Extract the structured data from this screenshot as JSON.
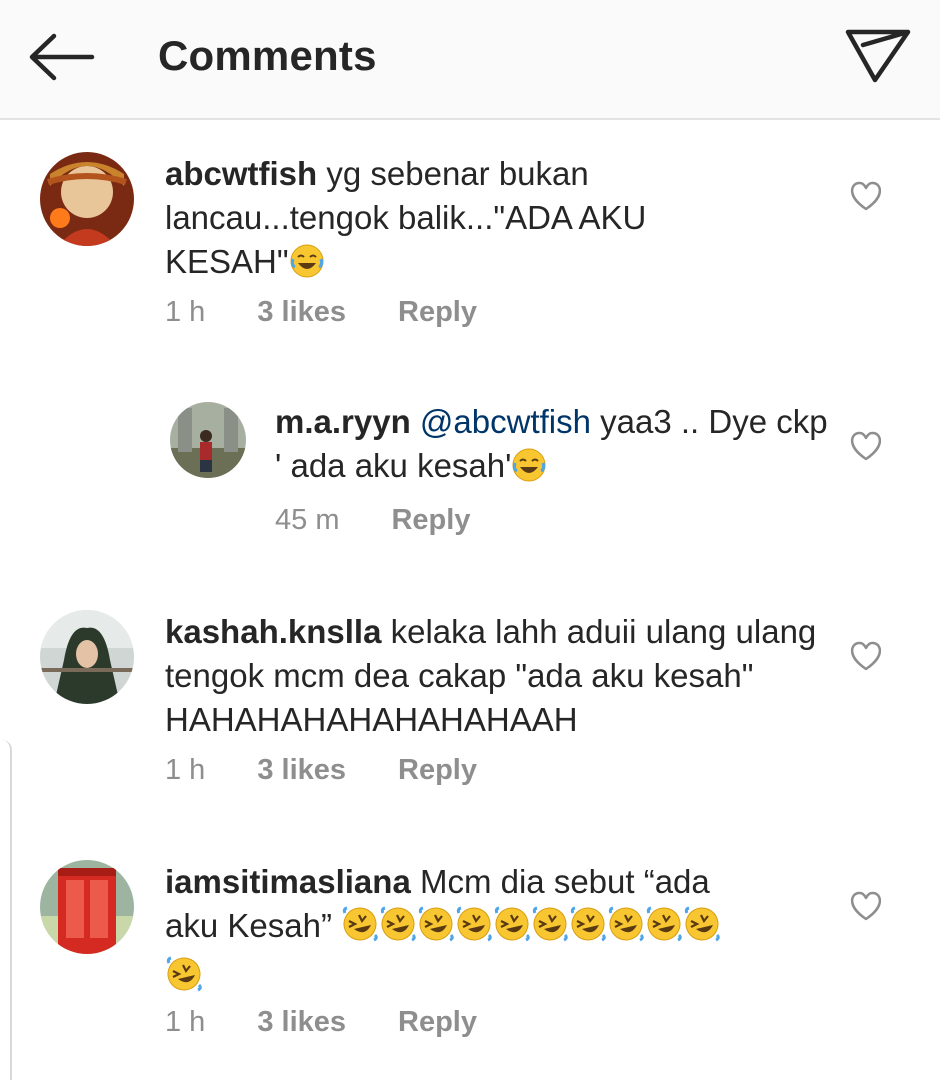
{
  "header": {
    "title": "Comments",
    "back_icon": "arrow-left-icon",
    "send_icon": "paper-plane-icon"
  },
  "comments": [
    {
      "username": "abcwtfish",
      "text": "yg sebenar bukan lancau...tengok balik...\"ADA AKU KESAH\"",
      "emoji": [
        "😂"
      ],
      "time": "1 h",
      "likes": "3 likes",
      "reply": "Reply"
    },
    {
      "username": "m.a.ryyn",
      "mention": "@abcwtfish",
      "text": "yaa3 .. Dye ckp ' ada aku kesah'",
      "emoji": [
        "😂"
      ],
      "time": "45 m",
      "reply": "Reply"
    },
    {
      "username": "kashah.knslla",
      "text": "kelaka lahh aduii ulang ulang tengok mcm dea cakap \"ada aku kesah\" HAHAHAHAHAHAHAHAAH",
      "time": "1 h",
      "likes": "3 likes",
      "reply": "Reply"
    },
    {
      "username": "iamsitimasliana",
      "text": "Mcm dia sebut “ada aku Kesah”",
      "emoji": [
        "🤣",
        "🤣",
        "🤣",
        "🤣",
        "🤣",
        "🤣",
        "🤣",
        "🤣",
        "🤣",
        "🤣",
        "🤣"
      ],
      "time": "1 h",
      "likes": "3 likes",
      "reply": "Reply"
    }
  ],
  "colors": {
    "text": "#262626",
    "meta": "#8e8e8e",
    "mention": "#003569",
    "emoji": "#f8c630"
  }
}
